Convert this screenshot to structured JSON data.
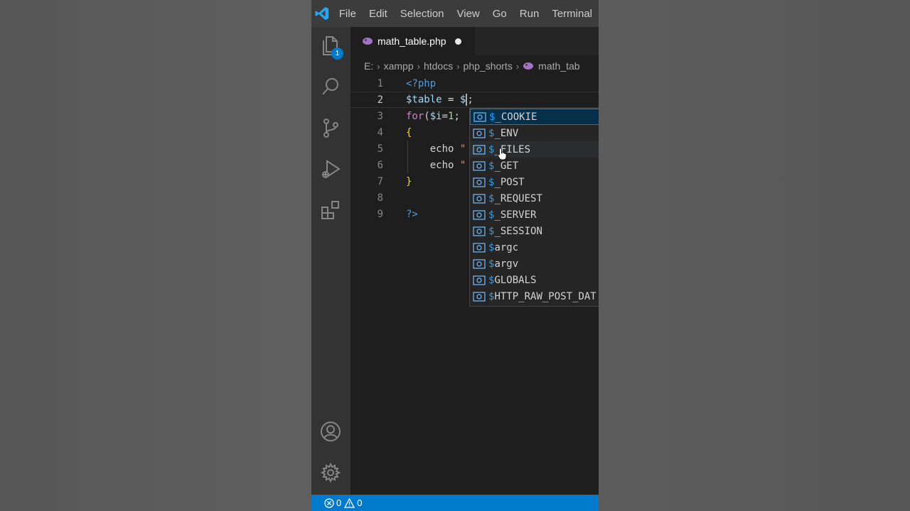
{
  "menu": [
    "File",
    "Edit",
    "Selection",
    "View",
    "Go",
    "Run",
    "Terminal"
  ],
  "activity": {
    "explorer_badge": "1",
    "icons": [
      "files-icon",
      "search-icon",
      "source-control-icon",
      "run-debug-icon",
      "extensions-icon",
      "account-icon",
      "gear-icon"
    ]
  },
  "tab": {
    "filename": "math_table.php",
    "modified": true
  },
  "breadcrumb": [
    "E:",
    "xampp",
    "htdocs",
    "php_shorts",
    "math_tab"
  ],
  "editor": {
    "line_numbers": [
      "1",
      "2",
      "3",
      "4",
      "5",
      "6",
      "7",
      "8",
      "9"
    ],
    "active_line": 2
  },
  "suggestions": [
    {
      "prefix": "$",
      "rest": "_COOKIE"
    },
    {
      "prefix": "$",
      "rest": "_ENV"
    },
    {
      "prefix": "$",
      "rest": "_FILES"
    },
    {
      "prefix": "$",
      "rest": "_GET"
    },
    {
      "prefix": "$",
      "rest": "_POST"
    },
    {
      "prefix": "$",
      "rest": "_REQUEST"
    },
    {
      "prefix": "$",
      "rest": "_SERVER"
    },
    {
      "prefix": "$",
      "rest": "_SESSION"
    },
    {
      "prefix": "$",
      "rest": "argc"
    },
    {
      "prefix": "$",
      "rest": "argv"
    },
    {
      "prefix": "$",
      "rest": "GLOBALS"
    },
    {
      "prefix": "$",
      "rest": "HTTP_RAW_POST_DAT"
    }
  ],
  "status": {
    "errors": "0",
    "warnings": "0"
  },
  "colors": {
    "statusbar": "#007acc",
    "accent": "#18a3ff"
  }
}
